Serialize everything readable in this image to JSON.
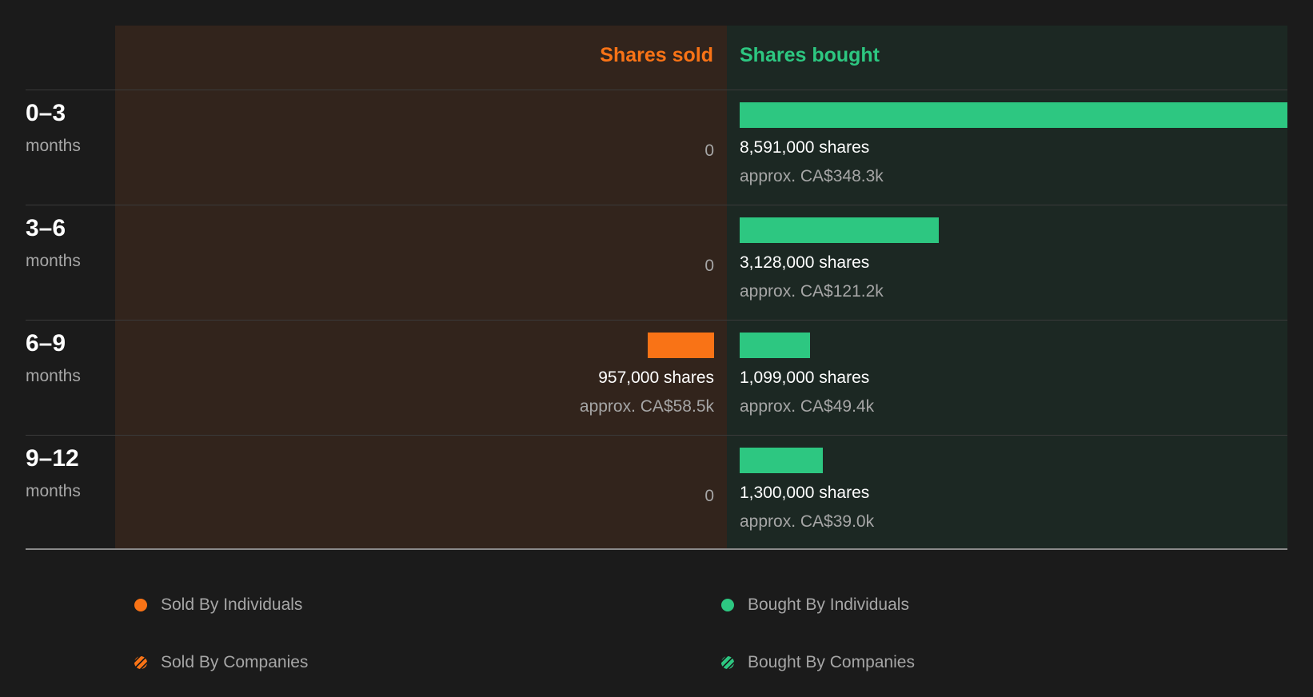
{
  "colors": {
    "sold": "#f97316",
    "bought": "#2dc781",
    "sold_bg": "#32241c",
    "bought_bg": "#1c2823"
  },
  "headers": {
    "sold": "Shares sold",
    "bought": "Shares bought"
  },
  "chart_data": {
    "type": "bar",
    "orientation": "horizontal-diverging",
    "categories": [
      "0-3",
      "3-6",
      "6-9",
      "9-12"
    ],
    "category_unit": "months",
    "series": [
      {
        "name": "Shares sold",
        "values": [
          0,
          0,
          957000,
          0
        ]
      },
      {
        "name": "Shares bought",
        "values": [
          8591000,
          3128000,
          1099000,
          1300000
        ]
      }
    ],
    "value_scale_max": 8591000,
    "rows": [
      {
        "period": "0–3",
        "unit": "months",
        "sold_label": "0",
        "sold_approx": "",
        "bought_label": "8,591,000 shares",
        "bought_approx": "approx. CA$348.3k"
      },
      {
        "period": "3–6",
        "unit": "months",
        "sold_label": "0",
        "sold_approx": "",
        "bought_label": "3,128,000 shares",
        "bought_approx": "approx. CA$121.2k"
      },
      {
        "period": "6–9",
        "unit": "months",
        "sold_label": "957,000 shares",
        "sold_approx": "approx. CA$58.5k",
        "bought_label": "1,099,000 shares",
        "bought_approx": "approx. CA$49.4k"
      },
      {
        "period": "9–12",
        "unit": "months",
        "sold_label": "0",
        "sold_approx": "",
        "bought_label": "1,300,000 shares",
        "bought_approx": "approx. CA$39.0k"
      }
    ]
  },
  "legend": [
    {
      "label": "Sold By Individuals",
      "color": "#f97316",
      "pattern": "solid"
    },
    {
      "label": "Bought By Individuals",
      "color": "#2dc781",
      "pattern": "solid"
    },
    {
      "label": "Sold By Companies",
      "color": "#f97316",
      "pattern": "striped"
    },
    {
      "label": "Bought By Companies",
      "color": "#2dc781",
      "pattern": "striped"
    }
  ]
}
